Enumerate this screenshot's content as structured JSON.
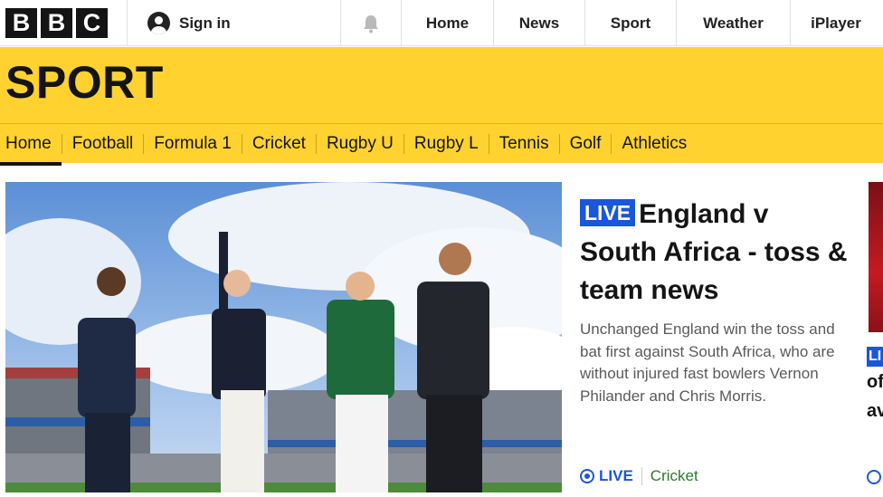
{
  "header": {
    "logo_letters": [
      "B",
      "B",
      "C"
    ],
    "signin_label": "Sign in",
    "notifications_icon": "bell-icon",
    "nav": [
      "Home",
      "News",
      "Sport",
      "Weather",
      "iPlayer"
    ]
  },
  "sport": {
    "title": "SPORT",
    "subnav": [
      "Home",
      "Football",
      "Formula 1",
      "Cricket",
      "Rugby U",
      "Rugby L",
      "Tennis",
      "Golf",
      "Athletics"
    ],
    "active": "Home"
  },
  "story": {
    "live_badge": "LIVE",
    "headline": "England v South Africa - toss & team news",
    "summary": "Unchanged England win the toss and bat first against South Africa, who are without injured fast bowlers Vernon Philander and Chris Morris.",
    "live_label": "LIVE",
    "tag": "Cricket"
  },
  "next_story": {
    "badge": "LI",
    "line1": "of",
    "line2": "av"
  },
  "colors": {
    "sport_yellow": "#ffd230",
    "live_blue": "#1a56db",
    "tag_green": "#2a7b2f"
  }
}
